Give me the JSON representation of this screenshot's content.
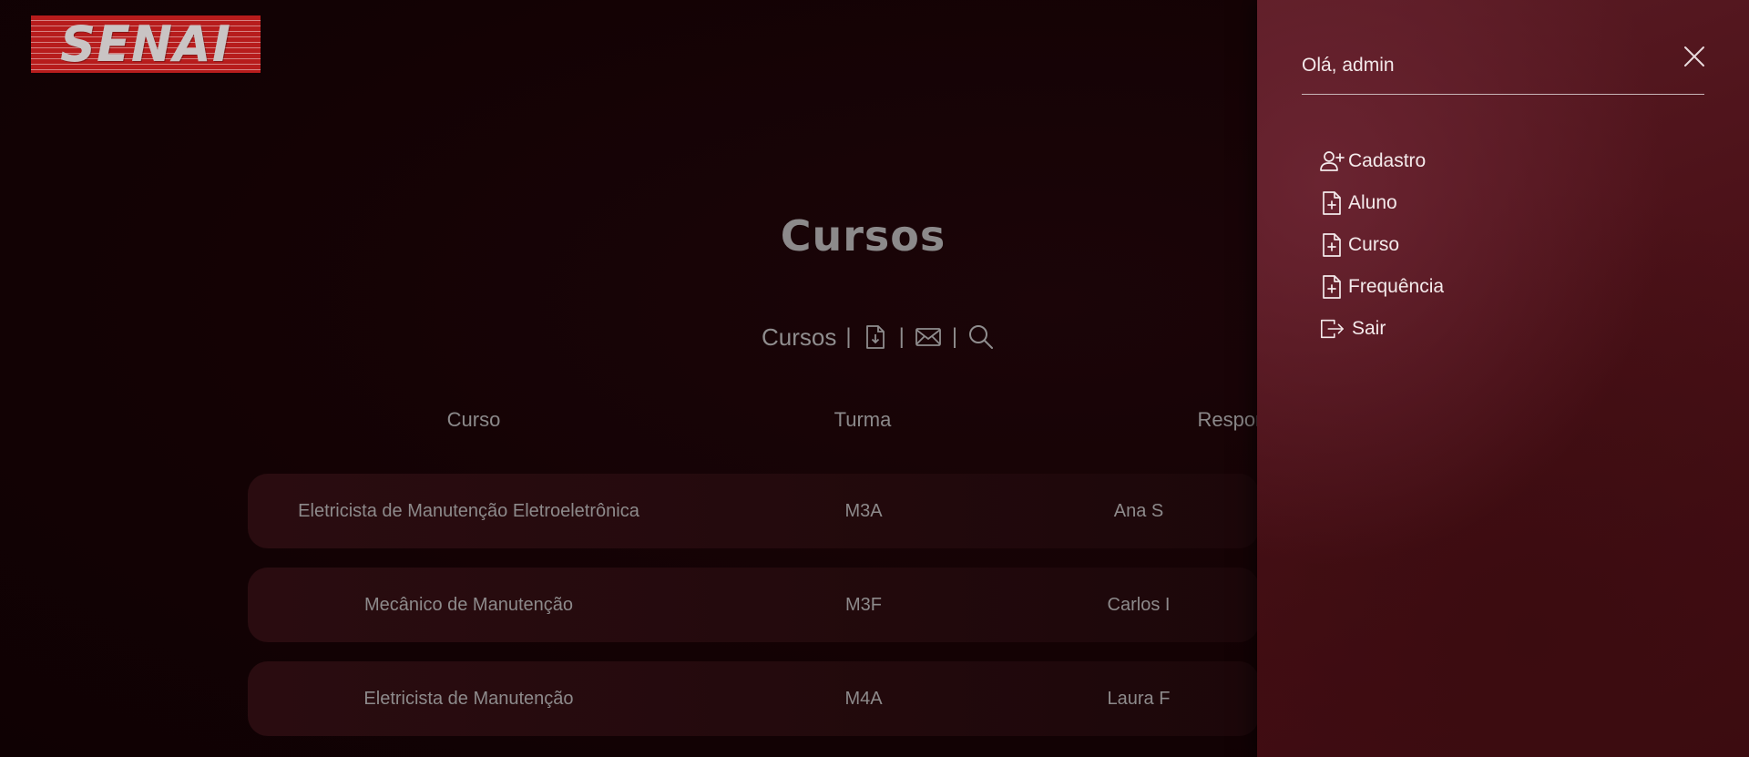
{
  "logo": {
    "text": "SENAI"
  },
  "main": {
    "title": "Cursos",
    "toolbar": {
      "label": "Cursos",
      "separator": "|",
      "icons": [
        "download-file-icon",
        "mail-icon",
        "search-icon"
      ]
    },
    "table": {
      "headers": [
        "Curso",
        "Turma",
        "Respor"
      ],
      "rows": [
        {
          "curso": "Eletricista de Manutenção Eletroeletrônica",
          "turma": "M3A",
          "responsavel": "Ana S"
        },
        {
          "curso": "Mecânico de Manutenção",
          "turma": "M3F",
          "responsavel": "Carlos I"
        },
        {
          "curso": "Eletricista de Manutenção",
          "turma": "M4A",
          "responsavel": "Laura F"
        }
      ]
    }
  },
  "side_panel": {
    "greeting": "Olá, admin",
    "menu": [
      {
        "label": "Cadastro",
        "icon": "user-add-icon"
      },
      {
        "label": "Aluno",
        "icon": "file-plus-icon"
      },
      {
        "label": "Curso",
        "icon": "file-plus-icon"
      },
      {
        "label": "Frequência",
        "icon": "file-plus-icon"
      },
      {
        "label": "Sair",
        "icon": "logout-icon"
      }
    ]
  },
  "colors": {
    "background": "#140305",
    "panel": "#4b1118",
    "logo_red": "#b71c1c",
    "muted_text": "#8d8a8b"
  }
}
